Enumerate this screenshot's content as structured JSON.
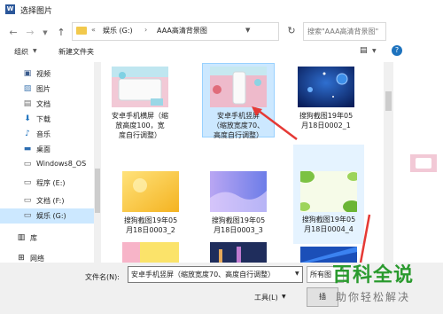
{
  "window": {
    "title": "选择图片",
    "app_icon": "W"
  },
  "nav": {
    "back_icon": "back-arrow-icon",
    "forward_icon": "forward-arrow-icon",
    "up_icon": "up-arrow-icon",
    "path_prefix": "«",
    "crumbs": [
      "娱乐 (G:)",
      "AAA高清背景图"
    ],
    "crumb_separator": "›",
    "search_placeholder": "搜索\"AAA高清背景图\""
  },
  "toolbar": {
    "organize_label": "组织",
    "new_folder_label": "新建文件夹"
  },
  "sidebar": {
    "items": [
      {
        "label": "视频",
        "icon": "video-icon"
      },
      {
        "label": "图片",
        "icon": "pictures-icon"
      },
      {
        "label": "文档",
        "icon": "documents-icon"
      },
      {
        "label": "下载",
        "icon": "download-icon"
      },
      {
        "label": "音乐",
        "icon": "music-icon"
      },
      {
        "label": "桌面",
        "icon": "desktop-icon"
      },
      {
        "label": "Windows8_OS",
        "icon": "drive-icon"
      },
      {
        "label": "程序 (E:)",
        "icon": "drive-icon"
      },
      {
        "label": "文档 (F:)",
        "icon": "drive-icon"
      },
      {
        "label": "娱乐 (G:)",
        "icon": "drive-icon",
        "selected": true
      },
      {
        "label": "库",
        "icon": "library-icon"
      },
      {
        "label": "网络",
        "icon": "network-icon"
      }
    ]
  },
  "files": [
    {
      "name_lines": [
        "安卓手机横屏（缩",
        "放高度100，宽",
        "度自行调整）"
      ]
    },
    {
      "name_lines": [
        "安卓手机竖屏",
        "（缩放宽度70、",
        "高度自行调整）"
      ],
      "selected": true
    },
    {
      "name_lines": [
        "搜狗截图19年05",
        "月18日0002_1"
      ]
    },
    {
      "name_lines": [
        "搜狗截图19年05",
        "月18日0003_2"
      ]
    },
    {
      "name_lines": [
        "搜狗截图19年05",
        "月18日0003_3"
      ]
    },
    {
      "name_lines": [
        "搜狗截图19年05",
        "月18日0004_4"
      ],
      "hover": true
    },
    {
      "name_lines": []
    },
    {
      "name_lines": []
    },
    {
      "name_lines": []
    }
  ],
  "bottom": {
    "filename_label": "文件名(N):",
    "filename_value": "安卓手机竖屏（缩放宽度70、高度自行调整）",
    "filter_label": "所有图",
    "tools_label": "工具(L)",
    "insert_label": "插"
  },
  "watermark": {
    "title": "百科全说",
    "subtitle": "助你轻松解决"
  },
  "colors": {
    "selection": "#cce8ff",
    "accent": "#1e73be",
    "watermark": "#2a9a2e"
  }
}
